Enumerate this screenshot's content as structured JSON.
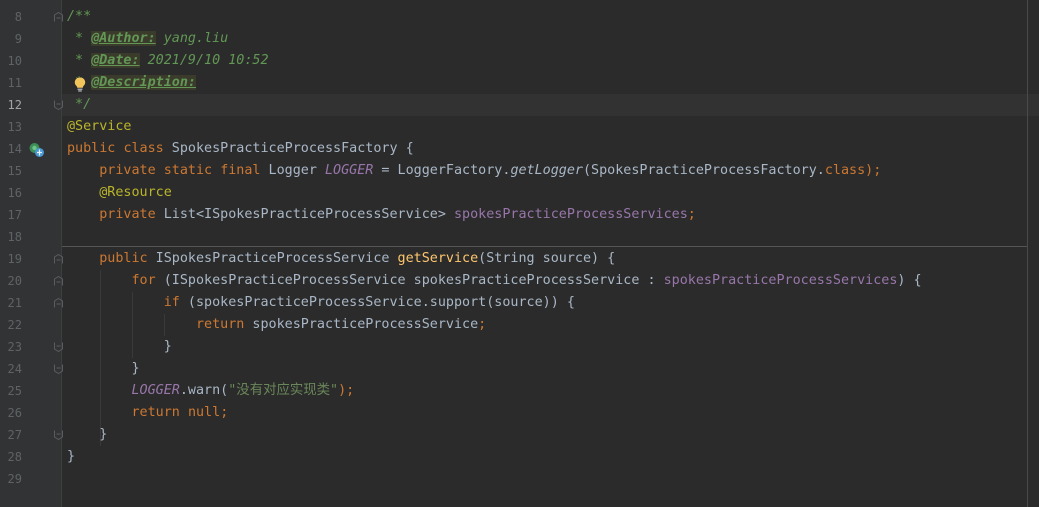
{
  "editor": {
    "language": "java",
    "current_line": "12",
    "lines": [
      {
        "num": "8",
        "t": [
          "/**"
        ]
      },
      {
        "num": "9",
        "t": [
          " * ",
          "@Author:",
          " yang.liu"
        ]
      },
      {
        "num": "10",
        "t": [
          " * ",
          "@Date:",
          " 2021/9/10 10:52"
        ]
      },
      {
        "num": "11",
        "t": [
          " * ",
          "@Description:"
        ]
      },
      {
        "num": "12",
        "t": [
          " */"
        ]
      },
      {
        "num": "13",
        "t": [
          "@Service"
        ]
      },
      {
        "num": "14",
        "t": [
          "public",
          " ",
          "class",
          " SpokesPracticeProcessFactory {"
        ]
      },
      {
        "num": "15",
        "t": [
          "    ",
          "private",
          " ",
          "static",
          " ",
          "final",
          " Logger ",
          "LOGGER",
          " = LoggerFactory.",
          "getLogger",
          "(SpokesPracticeProcessFactory.",
          "class",
          ");"
        ]
      },
      {
        "num": "16",
        "t": [
          "    ",
          "@Resource"
        ]
      },
      {
        "num": "17",
        "t": [
          "    ",
          "private",
          " List<ISpokesPracticeProcessService> ",
          "spokesPracticeProcessServices",
          ";"
        ]
      },
      {
        "num": "18",
        "t": [
          ""
        ]
      },
      {
        "num": "19",
        "t": [
          "    ",
          "public",
          " ISpokesPracticeProcessService ",
          "getService",
          "(String source) {"
        ]
      },
      {
        "num": "20",
        "t": [
          "        ",
          "for",
          " (ISpokesPracticeProcessService spokesPracticeProcessService : ",
          "spokesPracticeProcessServices",
          ") {"
        ]
      },
      {
        "num": "21",
        "t": [
          "            ",
          "if",
          " (spokesPracticeProcessService.support(source)) {"
        ]
      },
      {
        "num": "22",
        "t": [
          "                ",
          "return",
          " spokesPracticeProcessService",
          ";"
        ]
      },
      {
        "num": "23",
        "t": [
          "            }"
        ]
      },
      {
        "num": "24",
        "t": [
          "        }"
        ]
      },
      {
        "num": "25",
        "t": [
          "        ",
          "LOGGER",
          ".warn(",
          "\"没有对应实现类\"",
          ");"
        ]
      },
      {
        "num": "26",
        "t": [
          "        ",
          "return",
          " ",
          "null",
          ";"
        ]
      },
      {
        "num": "27",
        "t": [
          "    }"
        ]
      },
      {
        "num": "28",
        "t": [
          "}"
        ]
      },
      {
        "num": "29",
        "t": [
          ""
        ]
      }
    ]
  },
  "icons": {
    "bulb": "lightbulb-icon",
    "bean": "spring-bean-icon",
    "fold": "fold-marker-icon"
  },
  "colors": {
    "background": "#2b2b2b",
    "gutter": "#313335",
    "keyword": "#cc7832",
    "annotation": "#bbb529",
    "method": "#ffc66d",
    "field": "#9876aa",
    "string": "#6a8759",
    "javadoc": "#629755"
  }
}
